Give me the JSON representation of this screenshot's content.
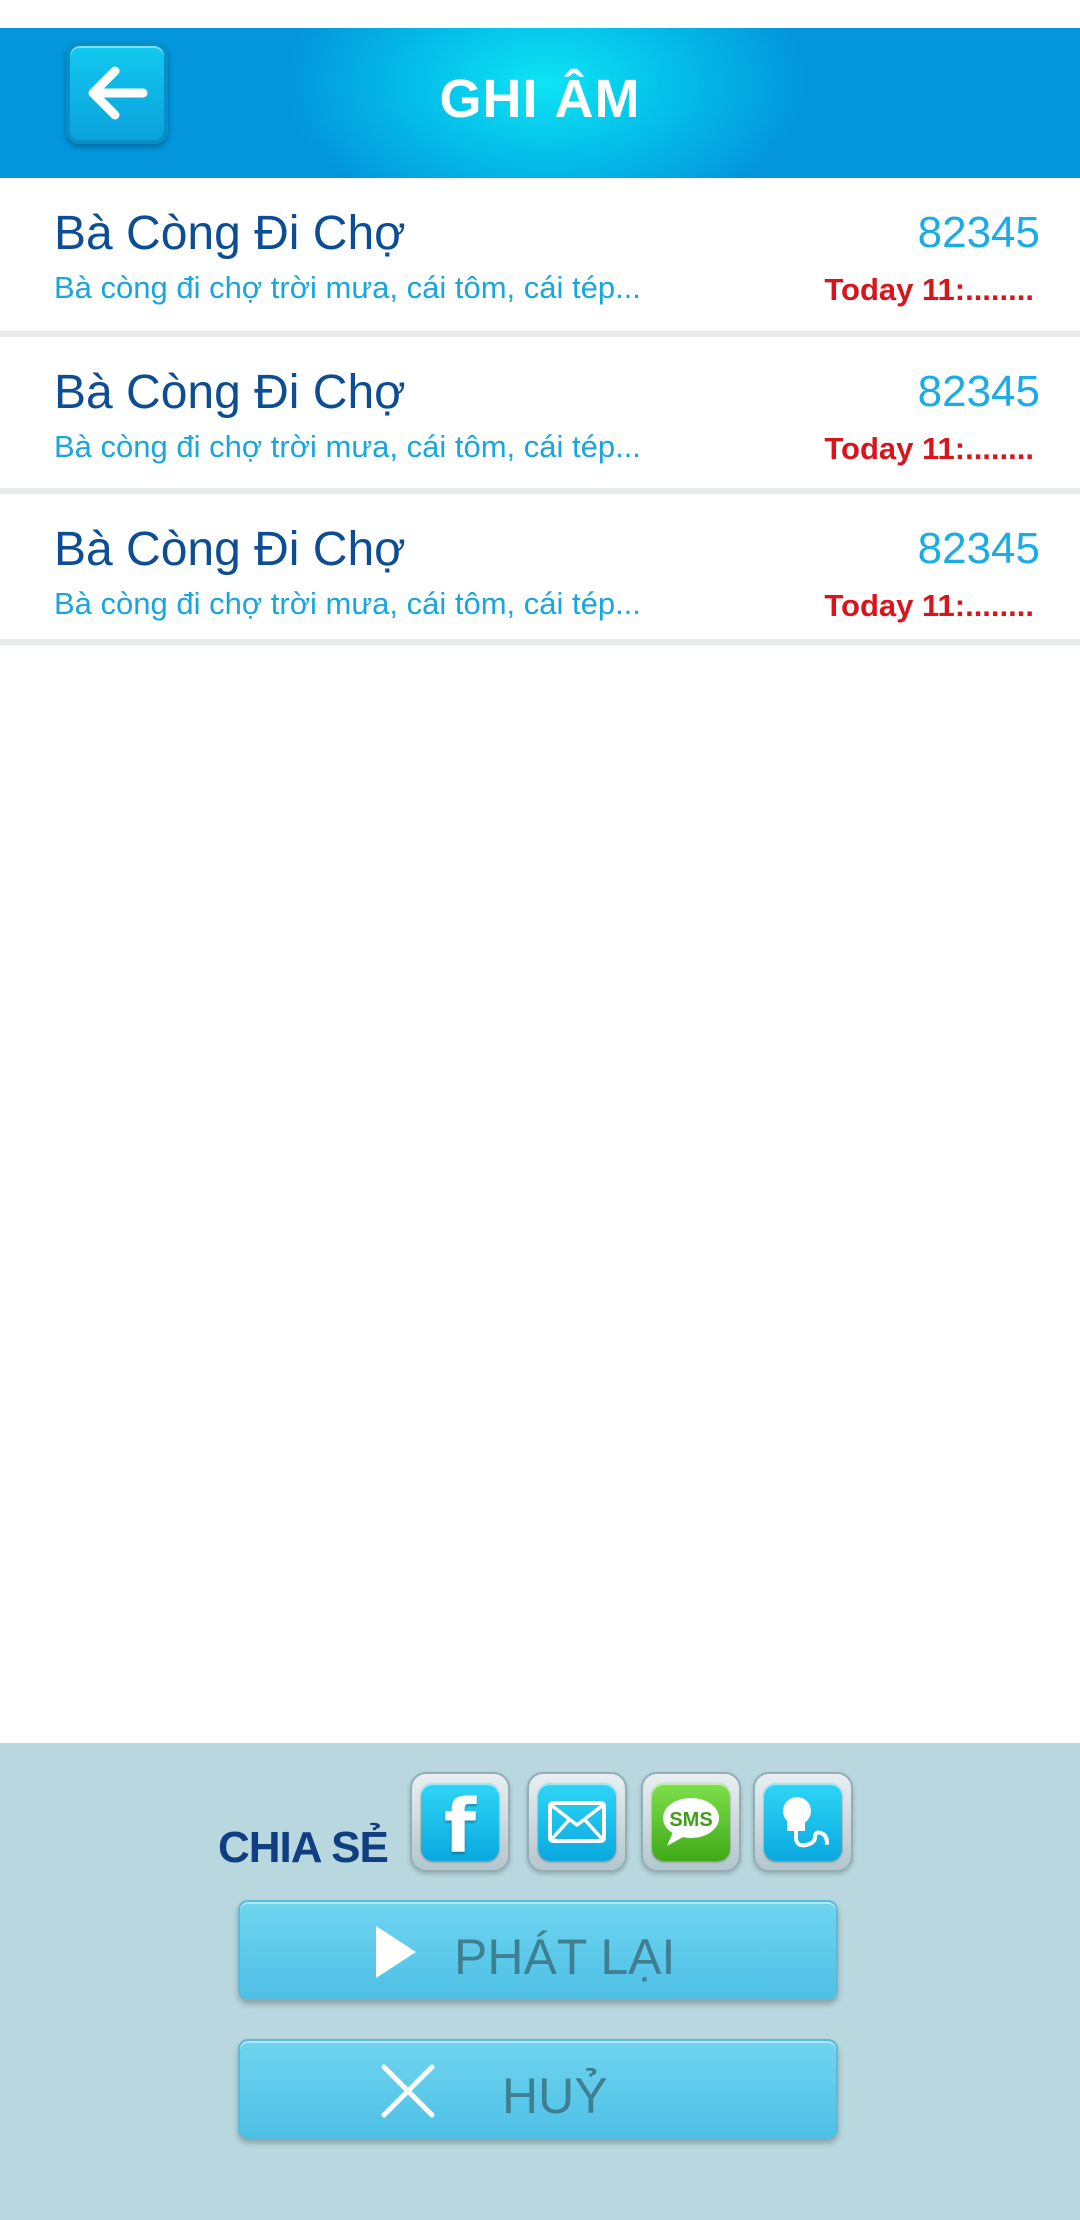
{
  "header": {
    "title": "GHI ÂM",
    "back_icon": "arrow-left-icon"
  },
  "recordings": [
    {
      "title": "Bà Còng Đi Chợ",
      "snippet": "Bà còng đi chợ trời mưa, cái tôm, cái tép...",
      "code": "82345",
      "time": "Today 11:........"
    },
    {
      "title": "Bà Còng Đi Chợ",
      "snippet": "Bà còng đi chợ trời mưa, cái tôm, cái tép...",
      "code": "82345",
      "time": "Today 11:........"
    },
    {
      "title": "Bà Còng Đi Chợ",
      "snippet": "Bà còng đi chợ trời mưa, cái tôm, cái tép...",
      "code": "82345",
      "time": "Today 11:........"
    }
  ],
  "share": {
    "label": "CHIA SẺ",
    "buttons": [
      {
        "icon": "facebook-icon",
        "glyph": "f"
      },
      {
        "icon": "email-icon"
      },
      {
        "icon": "sms-icon",
        "text": "SMS"
      },
      {
        "icon": "microphone-icon"
      }
    ]
  },
  "actions": {
    "replay_label": "PHÁT LẠI",
    "cancel_label": "HUỶ"
  },
  "colors": {
    "header_blue": "#0396dc",
    "title_navy": "#0d4d93",
    "accent_cyan": "#1aace4",
    "time_red": "#d8141c",
    "panel_bg": "#b8d7de"
  }
}
